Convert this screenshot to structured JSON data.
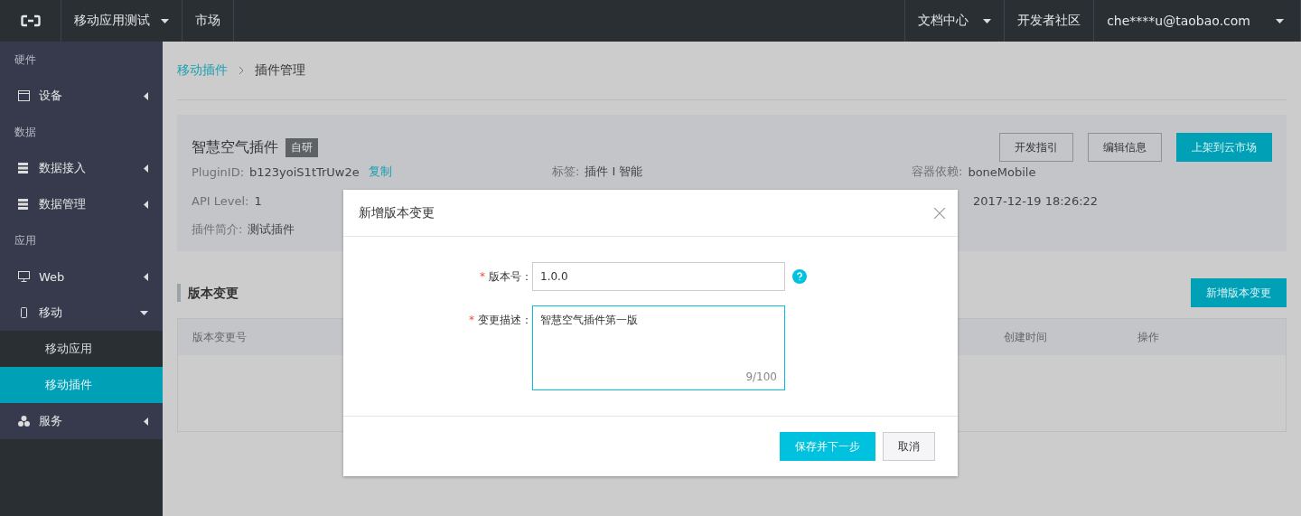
{
  "topbar": {
    "menus": [
      {
        "label": "移动应用测试",
        "dropdown": true
      },
      {
        "label": "市场",
        "dropdown": false
      }
    ],
    "right_menus": [
      {
        "label": "文档中心",
        "dropdown": true
      },
      {
        "label": "开发者社区",
        "dropdown": false
      },
      {
        "label": "che****u@taobao.com",
        "dropdown": true
      }
    ]
  },
  "sidebar": {
    "groups": [
      {
        "title": "硬件",
        "items": [
          {
            "label": "设备",
            "expanded": false
          }
        ]
      },
      {
        "title": "数据",
        "items": [
          {
            "label": "数据接入",
            "expanded": false
          },
          {
            "label": "数据管理",
            "expanded": false
          }
        ]
      },
      {
        "title": "应用",
        "items": [
          {
            "label": "Web",
            "expanded": false
          },
          {
            "label": "移动",
            "expanded": true,
            "children": [
              {
                "label": "移动应用",
                "selected": false
              },
              {
                "label": "移动插件",
                "selected": true
              }
            ]
          },
          {
            "label": "服务",
            "expanded": false
          }
        ]
      }
    ]
  },
  "breadcrumb": [
    {
      "label": "移动插件",
      "link": true
    },
    {
      "label": "插件管理",
      "link": false
    }
  ],
  "plugin": {
    "name": "智慧空气插件",
    "badge": "自研",
    "buttons": [
      {
        "label": "开发指引",
        "primary": false
      },
      {
        "label": "编辑信息",
        "primary": false
      },
      {
        "label": "上架到云市场",
        "primary": true
      }
    ],
    "fields": [
      {
        "label": "PluginID:",
        "value": "b123yoiS1tTrUw2e",
        "action": "复制"
      },
      {
        "label": "标签:",
        "value": "插件 I 智能"
      },
      {
        "label": "容器依赖:",
        "value": "boneMobile"
      },
      {
        "label": "API Level:",
        "value": "1"
      },
      {
        "value": "2017-12-19 18:26:22"
      },
      {
        "label": "插件简介:",
        "value": "测试插件"
      }
    ]
  },
  "versions": {
    "title": "版本变更",
    "add_button": "新增版本变更",
    "columns": [
      "版本变更号",
      "创建时间",
      "操作"
    ]
  },
  "dialog": {
    "title": "新增版本变更",
    "fields": [
      {
        "kind": "input",
        "label": "版本号：",
        "required_mark": "*",
        "value": "1.0.0",
        "help": true,
        "focused": false
      },
      {
        "kind": "textarea",
        "label": "变更描述：",
        "required_mark": "*",
        "value": "智慧空气插件第一版",
        "counter": "9/100",
        "help": false,
        "focused": true
      }
    ],
    "buttons": [
      {
        "label": "保存并下一步",
        "primary": true
      },
      {
        "label": "取消",
        "primary": false
      }
    ]
  }
}
